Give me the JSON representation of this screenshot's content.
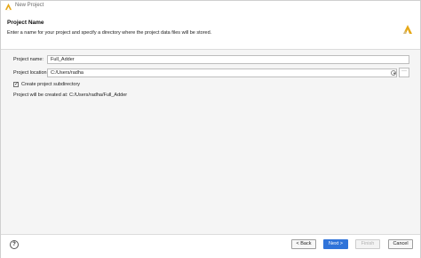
{
  "window": {
    "title": "New Project"
  },
  "header": {
    "title": "Project Name",
    "description": "Enter a name for your project and specify a directory where the project data files will be stored."
  },
  "form": {
    "project_name_label": "Project name:",
    "project_name_value": "Full_Adder",
    "project_location_label": "Project location:",
    "project_location_value": "C:/Users/radha",
    "browse_label": "···",
    "create_subdirectory_label": "Create project subdirectory",
    "create_subdirectory_checked": true,
    "created_at_text": "Project will be created at: C:/Users/radha/Full_Adder"
  },
  "footer": {
    "help_label": "?",
    "back_label": "< Back",
    "next_label": "Next >",
    "finish_label": "Finish",
    "cancel_label": "Cancel"
  },
  "colors": {
    "accent": "#2f73d9",
    "content_bg": "#f5f5f5"
  },
  "icons": {
    "app": "vivado-logo-icon",
    "header": "vivado-logo-icon"
  }
}
